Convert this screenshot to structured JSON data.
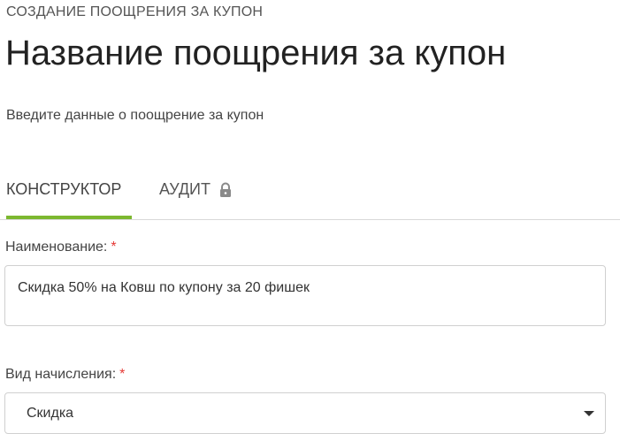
{
  "header": {
    "overline": "СОЗДАНИЕ ПООЩРЕНИЯ ЗА КУПОН",
    "title": "Название поощрения за купон",
    "subtitle": "Введите данные о поощрение за купон"
  },
  "tabs": [
    {
      "label": "КОНСТРУКТОР",
      "active": true
    },
    {
      "label": "АУДИТ",
      "active": false,
      "icon": "lock-icon",
      "locked": true
    }
  ],
  "form": {
    "name_field": {
      "label": "Наименование:",
      "required_mark": "*",
      "value": "Скидка 50% на Ковш по купону за 20 фишек"
    },
    "accrual_type_field": {
      "label": "Вид начисления:",
      "required_mark": "*",
      "value": "Скидка",
      "icon": "caret-down-icon"
    }
  },
  "colors": {
    "accent": "#7cb82f",
    "required": "#e53935",
    "border": "#d0d0d0"
  }
}
